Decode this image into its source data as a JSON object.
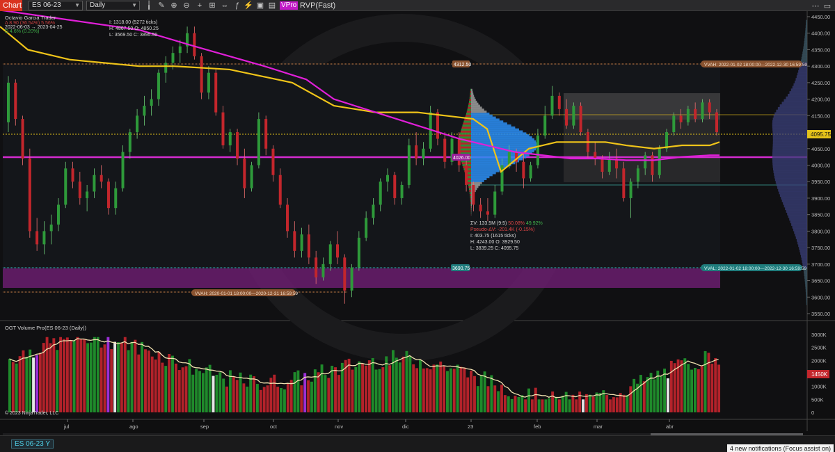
{
  "toolbar": {
    "chart_tab": "Chart",
    "instrument": "ES 06-23",
    "interval": "Daily",
    "vp_badge": "VPro",
    "indicator": "RVP(Fast)"
  },
  "info": {
    "author": "Octavio Garcia Trader",
    "line2": "Δ 8.90 (36.54%) 5.56%",
    "period": "2022-06-03 → 2023-04-25",
    "line4": "D 4.6% (0.20%)",
    "ticks": "I: 1318.00 (5272 ticks)",
    "hi_open": "H: 4867.50  O: 4850.25",
    "lo_close": "L: 3569.50  C: 3895.50"
  },
  "stats2": {
    "tv": "ΣV: 133.5M (9:5)",
    "tv_pct_red": "50.08%",
    "tv_pct_green": "49.92%",
    "pseudo": "Pseudo-ΔV: -201.4K (-0.15%)",
    "ticks": "I: 403.75 (1615 ticks)",
    "hi_open": "H: 4243.00  O: 3929.50",
    "lo_close": "L: 3839.25  C: 4095.75"
  },
  "levels": {
    "vvah_2022_price": "4312.50",
    "vvah_2022_label": "VVAH: 2022-01-02 18:00:00—2022-12-30 16:59:59",
    "vval_2022_price": "3690.75",
    "vval_2022_label": "VVAL: 2022-01-02 18:00:00—2022-12-30 16:59:59",
    "vvah_2020_label": "VVAH: 2020-01-01 18:00:00—2020-12-31 16:59:59",
    "poc_price": "4026.00",
    "last_price": "4095.75"
  },
  "price_axis": [
    "4450.00",
    "4400.00",
    "4350.00",
    "4300.00",
    "4250.00",
    "4200.00",
    "4150.00",
    "4100.00",
    "4050.00",
    "4000.00",
    "3950.00",
    "3900.00",
    "3850.00",
    "3800.00",
    "3750.00",
    "3700.00",
    "3650.00",
    "3600.00",
    "3550.00"
  ],
  "lower_panel": {
    "title": "OGT Volume Pro(ES 06-23 (Daily))",
    "copyright": "© 2023 NinjaTrader, LLC",
    "axis": [
      "3000K",
      "2500K",
      "2000K",
      "1500K",
      "1000K",
      "500K",
      "0"
    ],
    "last_volume": "1450K"
  },
  "time_axis": [
    "jul",
    "ago",
    "sep",
    "oct",
    "nov",
    "dic",
    "23",
    "feb",
    "mar",
    "abr"
  ],
  "bottom": {
    "instrument_tab": "ES 06-23",
    "notification": "4 new notifications (Focus assist on)"
  },
  "colors": {
    "up": "#2e9a3a",
    "down": "#c3262c",
    "sma_yellow": "#f0c419",
    "sma_magenta": "#e01fd8",
    "poc": "#d42bd0",
    "vvah": "#d7874a",
    "vval": "#34c7c7"
  },
  "chart_data": {
    "type": "candlestick",
    "ylim": [
      3540,
      4470
    ],
    "candles": [
      [
        4130,
        4270,
        4100,
        4250
      ],
      [
        4250,
        4260,
        4120,
        4140
      ],
      [
        4140,
        4150,
        4000,
        4020
      ],
      [
        4020,
        4050,
        3780,
        3800
      ],
      [
        3800,
        3840,
        3740,
        3760
      ],
      [
        3760,
        3830,
        3730,
        3800
      ],
      [
        3800,
        3850,
        3760,
        3820
      ],
      [
        3820,
        3900,
        3800,
        3880
      ],
      [
        3880,
        4010,
        3870,
        3990
      ],
      [
        3990,
        4010,
        3930,
        3950
      ],
      [
        3950,
        3980,
        3880,
        3900
      ],
      [
        3900,
        3940,
        3860,
        3920
      ],
      [
        3920,
        3990,
        3900,
        3970
      ],
      [
        3970,
        4000,
        3930,
        3950
      ],
      [
        3950,
        3960,
        3850,
        3870
      ],
      [
        3870,
        3950,
        3850,
        3930
      ],
      [
        3930,
        4060,
        3920,
        4040
      ],
      [
        4040,
        4110,
        4020,
        4100
      ],
      [
        4100,
        4170,
        4080,
        4150
      ],
      [
        4150,
        4210,
        4120,
        4180
      ],
      [
        4180,
        4230,
        4150,
        4200
      ],
      [
        4200,
        4290,
        4180,
        4280
      ],
      [
        4280,
        4330,
        4250,
        4310
      ],
      [
        4310,
        4360,
        4290,
        4340
      ],
      [
        4340,
        4380,
        4310,
        4360
      ],
      [
        4360,
        4420,
        4340,
        4400
      ],
      [
        4400,
        4420,
        4320,
        4330
      ],
      [
        4330,
        4340,
        4200,
        4220
      ],
      [
        4220,
        4300,
        4200,
        4280
      ],
      [
        4280,
        4290,
        4150,
        4160
      ],
      [
        4160,
        4180,
        4050,
        4060
      ],
      [
        4060,
        4110,
        4040,
        4100
      ],
      [
        4100,
        4110,
        4000,
        4020
      ],
      [
        4020,
        4050,
        3900,
        3930
      ],
      [
        3930,
        4010,
        3920,
        4000
      ],
      [
        4000,
        4160,
        3990,
        4140
      ],
      [
        4140,
        4150,
        4030,
        4050
      ],
      [
        4050,
        4060,
        3950,
        3970
      ],
      [
        3970,
        3990,
        3870,
        3880
      ],
      [
        3880,
        3900,
        3780,
        3800
      ],
      [
        3800,
        3830,
        3720,
        3740
      ],
      [
        3740,
        3810,
        3720,
        3790
      ],
      [
        3790,
        3820,
        3700,
        3720
      ],
      [
        3720,
        3740,
        3640,
        3660
      ],
      [
        3660,
        3720,
        3650,
        3700
      ],
      [
        3700,
        3770,
        3680,
        3760
      ],
      [
        3760,
        3800,
        3700,
        3720
      ],
      [
        3720,
        3730,
        3580,
        3620
      ],
      [
        3620,
        3700,
        3600,
        3690
      ],
      [
        3690,
        3800,
        3680,
        3780
      ],
      [
        3780,
        3860,
        3770,
        3840
      ],
      [
        3840,
        3900,
        3820,
        3880
      ],
      [
        3880,
        3960,
        3860,
        3950
      ],
      [
        3950,
        3990,
        3920,
        3970
      ],
      [
        3970,
        3980,
        3880,
        3900
      ],
      [
        3900,
        3950,
        3880,
        3940
      ],
      [
        3940,
        4080,
        3930,
        4060
      ],
      [
        4060,
        4100,
        4000,
        4020
      ],
      [
        4020,
        4070,
        4000,
        4050
      ],
      [
        4050,
        4180,
        4040,
        4160
      ],
      [
        4160,
        4170,
        4060,
        4080
      ],
      [
        4080,
        4100,
        3990,
        4010
      ],
      [
        4010,
        4100,
        4000,
        4080
      ],
      [
        4080,
        4100,
        3980,
        4000
      ],
      [
        4000,
        4020,
        3920,
        3940
      ],
      [
        3940,
        3950,
        3860,
        3880
      ],
      [
        3880,
        3900,
        3840,
        3860
      ],
      [
        3860,
        3900,
        3830,
        3850
      ],
      [
        3850,
        3940,
        3840,
        3920
      ],
      [
        3920,
        4020,
        3910,
        4000
      ],
      [
        4000,
        4060,
        3990,
        4040
      ],
      [
        4040,
        4050,
        3980,
        4010
      ],
      [
        4010,
        4040,
        3930,
        3960
      ],
      [
        3960,
        4010,
        3950,
        4000
      ],
      [
        4000,
        4110,
        3990,
        4090
      ],
      [
        4090,
        4180,
        4080,
        4150
      ],
      [
        4150,
        4240,
        4140,
        4210
      ],
      [
        4210,
        4220,
        4150,
        4170
      ],
      [
        4170,
        4200,
        4110,
        4120
      ],
      [
        4120,
        4190,
        4110,
        4180
      ],
      [
        4180,
        4190,
        4090,
        4100
      ],
      [
        4100,
        4110,
        4020,
        4040
      ],
      [
        4040,
        4070,
        4000,
        4020
      ],
      [
        4020,
        4030,
        3960,
        3980
      ],
      [
        3980,
        4040,
        3970,
        4020
      ],
      [
        4020,
        4050,
        3960,
        3990
      ],
      [
        3990,
        4010,
        3890,
        3900
      ],
      [
        3900,
        3960,
        3840,
        3950
      ],
      [
        3950,
        4000,
        3930,
        3990
      ],
      [
        3990,
        4040,
        3970,
        4030
      ],
      [
        4030,
        4040,
        3950,
        3970
      ],
      [
        3970,
        4060,
        3960,
        4050
      ],
      [
        4050,
        4110,
        4040,
        4100
      ],
      [
        4100,
        4160,
        4090,
        4150
      ],
      [
        4150,
        4170,
        4110,
        4130
      ],
      [
        4130,
        4180,
        4120,
        4170
      ],
      [
        4170,
        4190,
        4130,
        4140
      ],
      [
        4140,
        4200,
        4130,
        4190
      ],
      [
        4190,
        4200,
        4140,
        4160
      ],
      [
        4160,
        4170,
        4090,
        4100
      ]
    ],
    "sma_yellow": [
      [
        0,
        4420
      ],
      [
        40,
        4350
      ],
      [
        100,
        4320
      ],
      [
        200,
        4300
      ],
      [
        250,
        4300
      ],
      [
        330,
        4290
      ],
      [
        420,
        4250
      ],
      [
        480,
        4180
      ],
      [
        540,
        4160
      ],
      [
        600,
        4160
      ],
      [
        640,
        4150
      ],
      [
        680,
        4140
      ],
      [
        700,
        4110
      ],
      [
        720,
        3980
      ],
      [
        760,
        4050
      ],
      [
        800,
        4070
      ],
      [
        840,
        4070
      ],
      [
        870,
        4070
      ],
      [
        900,
        4060
      ],
      [
        940,
        4050
      ],
      [
        980,
        4060
      ],
      [
        1020,
        4060
      ],
      [
        1034,
        4070
      ]
    ],
    "sma_magenta": [
      [
        0,
        4470
      ],
      [
        100,
        4440
      ],
      [
        200,
        4410
      ],
      [
        280,
        4360
      ],
      [
        380,
        4300
      ],
      [
        440,
        4260
      ],
      [
        480,
        4200
      ],
      [
        540,
        4160
      ],
      [
        600,
        4120
      ],
      [
        660,
        4080
      ],
      [
        700,
        4060
      ],
      [
        740,
        4040
      ],
      [
        780,
        4030
      ],
      [
        820,
        4020
      ],
      [
        860,
        4020
      ],
      [
        900,
        4015
      ],
      [
        940,
        4015
      ],
      [
        980,
        4025
      ],
      [
        1020,
        4030
      ],
      [
        1034,
        4030
      ]
    ]
  }
}
